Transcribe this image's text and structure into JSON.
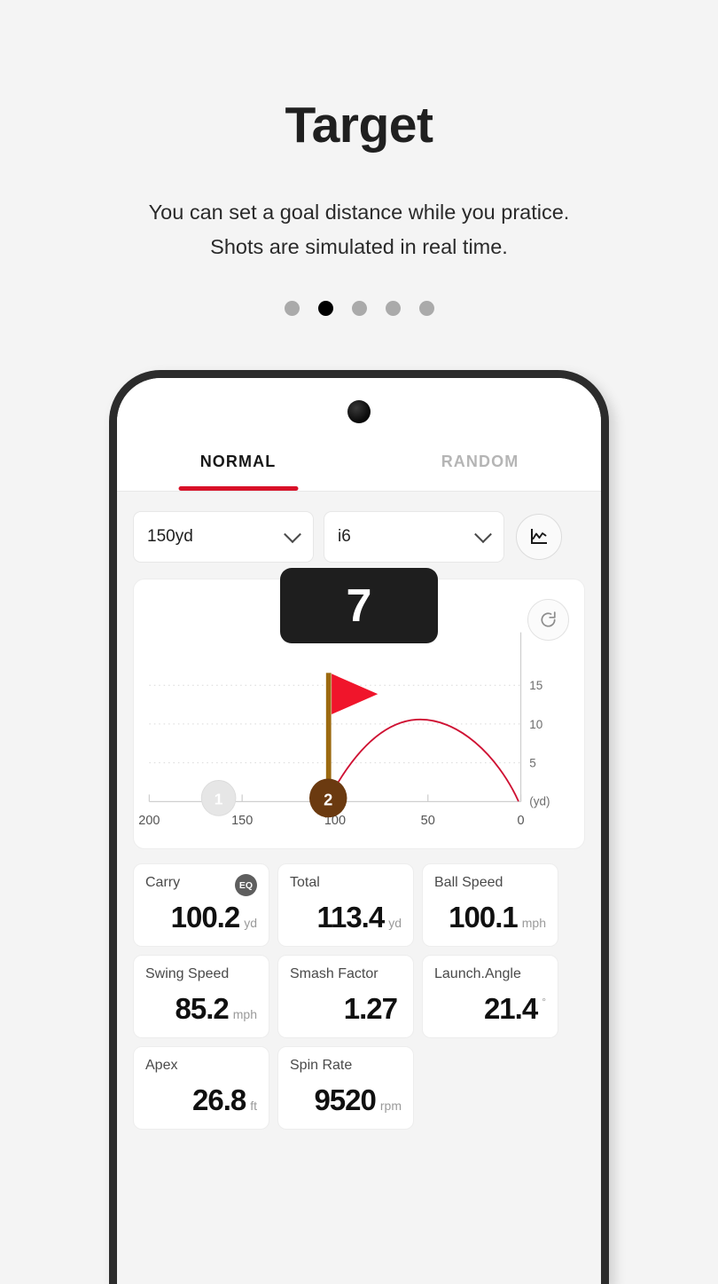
{
  "promo": {
    "title": "Target",
    "subtitle_line1": "You can set a goal distance while you pratice.",
    "subtitle_line2": "Shots are simulated in real time.",
    "dots_total": 5,
    "dots_active_index": 1
  },
  "app": {
    "tabs": [
      {
        "label": "NORMAL",
        "active": true
      },
      {
        "label": "RANDOM",
        "active": false
      }
    ],
    "controls": {
      "distance_value": "150yd",
      "club_value": "i6",
      "chart_toggle_icon": "line-chart-icon",
      "chevron_icon": "chevron-down-icon"
    },
    "chart_panel": {
      "shot_number": "7",
      "reset_icon": "refresh-icon"
    },
    "stats": [
      {
        "label": "Carry",
        "value": "100.2",
        "unit": "yd",
        "badge": "EQ"
      },
      {
        "label": "Total",
        "value": "113.4",
        "unit": "yd",
        "badge": null
      },
      {
        "label": "Ball Speed",
        "value": "100.1",
        "unit": "mph",
        "badge": null
      },
      {
        "label": "Swing Speed",
        "value": "85.2",
        "unit": "mph",
        "badge": null
      },
      {
        "label": "Smash Factor",
        "value": "1.27",
        "unit": "",
        "badge": null
      },
      {
        "label": "Launch.Angle",
        "value": "21.4",
        "unit": "°",
        "badge": null
      },
      {
        "label": "Apex",
        "value": "26.8",
        "unit": "ft",
        "badge": null
      },
      {
        "label": "Spin Rate",
        "value": "9520",
        "unit": "rpm",
        "badge": null
      }
    ]
  },
  "chart_data": {
    "type": "line",
    "title": "Shot trajectory",
    "xlabel": "(yd)",
    "ylabel": "",
    "x_ticks": [
      200,
      150,
      100,
      50,
      0
    ],
    "x_tick_labels": [
      "200",
      "150",
      "100",
      "50",
      "0"
    ],
    "xlim": [
      200,
      0
    ],
    "x_reversed": true,
    "y_ticks": [
      5,
      10,
      15
    ],
    "y_tick_labels": [
      "5",
      "10",
      "15"
    ],
    "ylim": [
      0,
      17
    ],
    "grid": "horizontal-dotted",
    "y_axis_position": "right",
    "series": [
      {
        "name": "trajectory",
        "color": "#cf1133",
        "x": [
          103,
          95,
          85,
          75,
          65,
          60,
          50,
          40,
          30,
          20,
          10,
          2,
          0
        ],
        "y": [
          0.6,
          3.2,
          6.2,
          8.2,
          9.5,
          9.8,
          9.9,
          9.4,
          8.2,
          6.2,
          3.4,
          0.6,
          0
        ]
      }
    ],
    "annotations": [
      {
        "type": "flag",
        "label": "target-flag",
        "x": 105,
        "height_yd": 13,
        "pole_color": "#9c6a10",
        "flag_color": "#f0152b"
      },
      {
        "type": "marker",
        "label": "1",
        "x": 163,
        "color": "#e3e3e3",
        "text_color": "#ffffff"
      },
      {
        "type": "marker",
        "label": "2",
        "x": 103,
        "color": "#6b3a10",
        "text_color": "#ffffff"
      }
    ],
    "axis_unit_label": "(yd)"
  },
  "colors": {
    "accent_red": "#d81128",
    "trajectory": "#cf1133",
    "flag_red": "#f0152b",
    "flag_pole": "#9c6a10",
    "marker_brown": "#6b3a10",
    "marker_gray": "#e3e3e3",
    "badge_dark": "#1e1e1e",
    "page_bg": "#f4f4f4"
  }
}
